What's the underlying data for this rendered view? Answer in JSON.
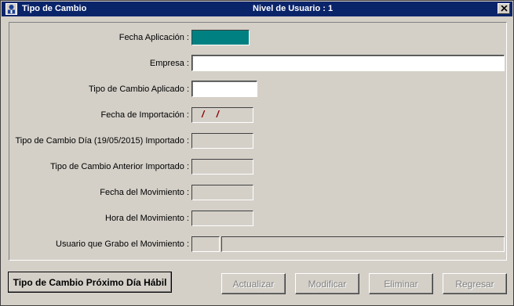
{
  "window": {
    "title": "Tipo de Cambio",
    "user_level": "Nivel de Usuario : 1",
    "close_symbol": "✕"
  },
  "form": {
    "fecha_aplicacion_label": "Fecha Aplicación :",
    "empresa_label": "Empresa :",
    "empresa_value": "",
    "tipo_cambio_aplicado_label": "Tipo de Cambio Aplicado :",
    "tipo_cambio_aplicado_value": "",
    "fecha_importacion_label": "Fecha de Importación :",
    "fecha_importacion_value": "/ /",
    "tipo_cambio_dia_label": "Tipo de Cambio Día (19/05/2015) Importado :",
    "tipo_cambio_anterior_label": "Tipo de Cambio Anterior Importado :",
    "fecha_movimiento_label": "Fecha del Movimiento :",
    "hora_movimiento_label": "Hora del Movimiento :",
    "usuario_movimiento_label": "Usuario que Grabo el Movimiento :"
  },
  "buttons": {
    "proximo_dia": "Tipo de Cambio Próximo Día Hábil",
    "actualizar": "Actualizar",
    "modificar": "Modificar",
    "eliminar": "Eliminar",
    "regresar": "Regresar"
  },
  "colors": {
    "titlebar": "#0a246a",
    "face": "#d4d0c8",
    "date_field": "#008080"
  }
}
